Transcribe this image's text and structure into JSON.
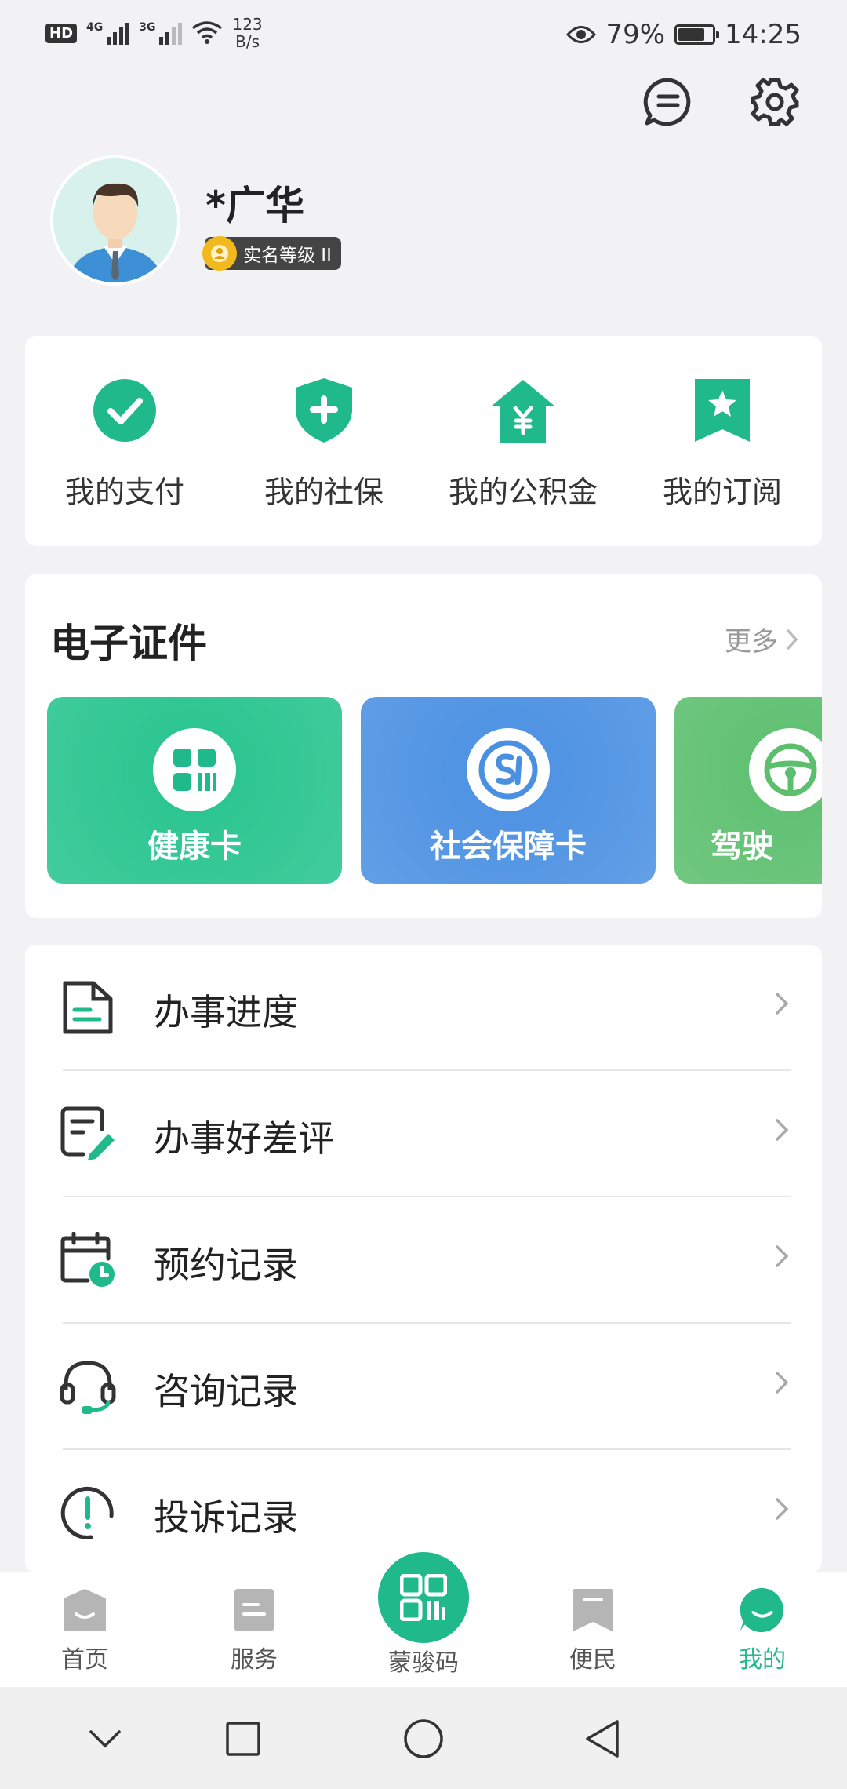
{
  "status_bar": {
    "hd": "HD",
    "sim1": "4G",
    "sim2": "3G",
    "speed_value": "123",
    "speed_unit": "B/s",
    "battery": "79%",
    "battery_level": 0.79,
    "time": "14:25"
  },
  "profile": {
    "name": "*广华",
    "realname_level": "实名等级 II"
  },
  "quick_actions": [
    {
      "label": "我的支付",
      "icon": "check-circle-icon"
    },
    {
      "label": "我的社保",
      "icon": "shield-plus-icon"
    },
    {
      "label": "我的公积金",
      "icon": "house-yuan-icon"
    },
    {
      "label": "我的订阅",
      "icon": "bookmark-star-icon"
    }
  ],
  "certificates": {
    "title": "电子证件",
    "more": "更多",
    "items": [
      {
        "label": "健康卡",
        "color": "#26c48e"
      },
      {
        "label": "社会保障卡",
        "color": "#4a90e2"
      },
      {
        "label": "驾驶",
        "color": "#5cbf6e"
      }
    ]
  },
  "menu": [
    {
      "label": "办事进度"
    },
    {
      "label": "办事好差评"
    },
    {
      "label": "预约记录"
    },
    {
      "label": "咨询记录"
    },
    {
      "label": "投诉记录"
    }
  ],
  "bottom_nav": [
    {
      "label": "首页"
    },
    {
      "label": "服务"
    },
    {
      "label": "蒙骏码"
    },
    {
      "label": "便民"
    },
    {
      "label": "我的"
    }
  ],
  "colors": {
    "accent": "#20b98c",
    "active_tab": "#20b98c",
    "inactive_tab": "#555555"
  }
}
